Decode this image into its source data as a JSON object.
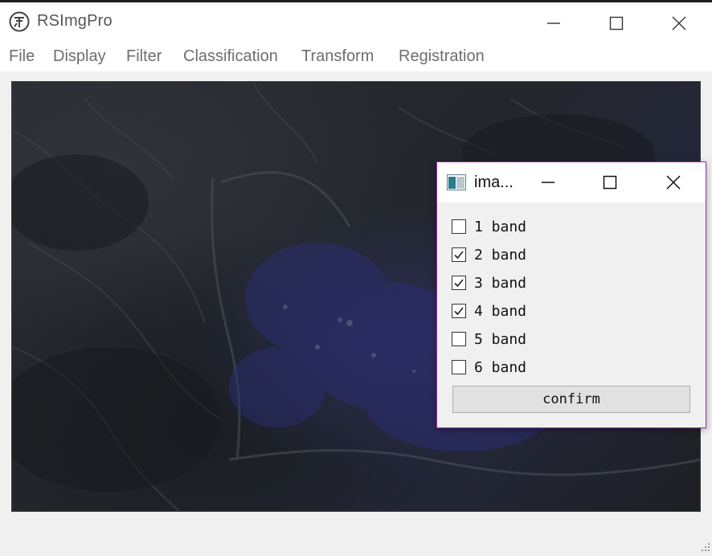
{
  "app": {
    "title": "RSImgPro",
    "logo_icon": "app-logo-icon"
  },
  "window_controls": [
    "minimize-icon",
    "maximize-icon",
    "close-icon"
  ],
  "menu": [
    "File",
    "Display",
    "Filter",
    "Classification",
    "Transform",
    "Registration"
  ],
  "image_view": {
    "content": "satellite-false-color-image",
    "accent_color": "#2a2d6a"
  },
  "dialog": {
    "title": "ima...",
    "icon": "image-window-icon",
    "border_color": "#9b2bb0",
    "bands": [
      {
        "label": "1 band",
        "checked": false
      },
      {
        "label": "2 band",
        "checked": true
      },
      {
        "label": "3 band",
        "checked": true
      },
      {
        "label": "4 band",
        "checked": true
      },
      {
        "label": "5 band",
        "checked": false
      },
      {
        "label": "6 band",
        "checked": false
      }
    ],
    "confirm_label": "confirm"
  }
}
